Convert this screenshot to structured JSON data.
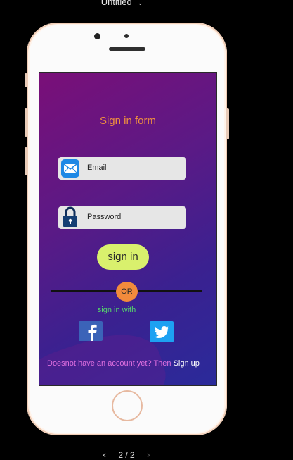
{
  "app": {
    "document_title": "Untitled"
  },
  "screen": {
    "form_title": "Sign in form",
    "email": {
      "label": "Email"
    },
    "password": {
      "label": "Password"
    },
    "signin_button": "sign in",
    "or_text": "OR",
    "signin_with_text": "sign in with",
    "social": [
      "facebook-icon",
      "twitter-icon"
    ],
    "signup_prompt": "Doesnot have  an account yet? Then ",
    "signup_link": "Sign up",
    "colors": {
      "title": "#f0913e",
      "button": "#d9f06d",
      "or_badge": "#f28b3c",
      "signin_with": "#55d86a",
      "prompt": "#e06fe0",
      "gradient_start": "#7a0f78",
      "gradient_end": "#2a2a9a"
    }
  },
  "pager": {
    "current": "2",
    "separator": "/",
    "total": "2",
    "label": "2 / 2"
  }
}
